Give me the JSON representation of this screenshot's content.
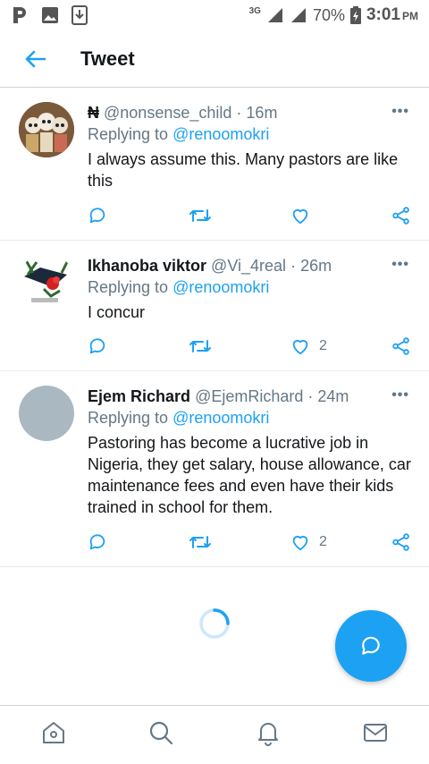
{
  "status": {
    "network": "3G",
    "battery": "70%",
    "time": "3:01",
    "ampm": "PM"
  },
  "header": {
    "title": "Tweet"
  },
  "tweets": [
    {
      "name": "₦",
      "handle": "@nonsense_child",
      "sep": "·",
      "time": "16m",
      "replying_label": "Replying to",
      "replying_to": "@renoomokri",
      "text": "I always assume this. Many pastors are like this",
      "likes": ""
    },
    {
      "name": "Ikhanoba viktor",
      "handle": "@Vi_4real",
      "sep": "·",
      "time": "26m",
      "replying_label": "Replying to",
      "replying_to": "@renoomokri",
      "text": "I concur",
      "likes": "2"
    },
    {
      "name": "Ejem Richard",
      "handle": "@EjemRichard",
      "sep": "·",
      "time": "24m",
      "replying_label": "Replying to",
      "replying_to": "@renoomokri",
      "text": "Pastoring has become a lucrative job in Nigeria, they get salary, house allowance, car maintenance fees and even have their kids trained in school for them.",
      "likes": "2"
    }
  ],
  "more_label": "•••",
  "colors": {
    "accent": "#1da1f2",
    "muted": "#657786"
  },
  "icons": [
    "back-arrow-icon",
    "more-icon",
    "reply-icon",
    "retweet-icon",
    "like-icon",
    "share-icon",
    "compose-reply-icon",
    "home-icon",
    "search-icon",
    "notifications-icon",
    "messages-icon"
  ]
}
